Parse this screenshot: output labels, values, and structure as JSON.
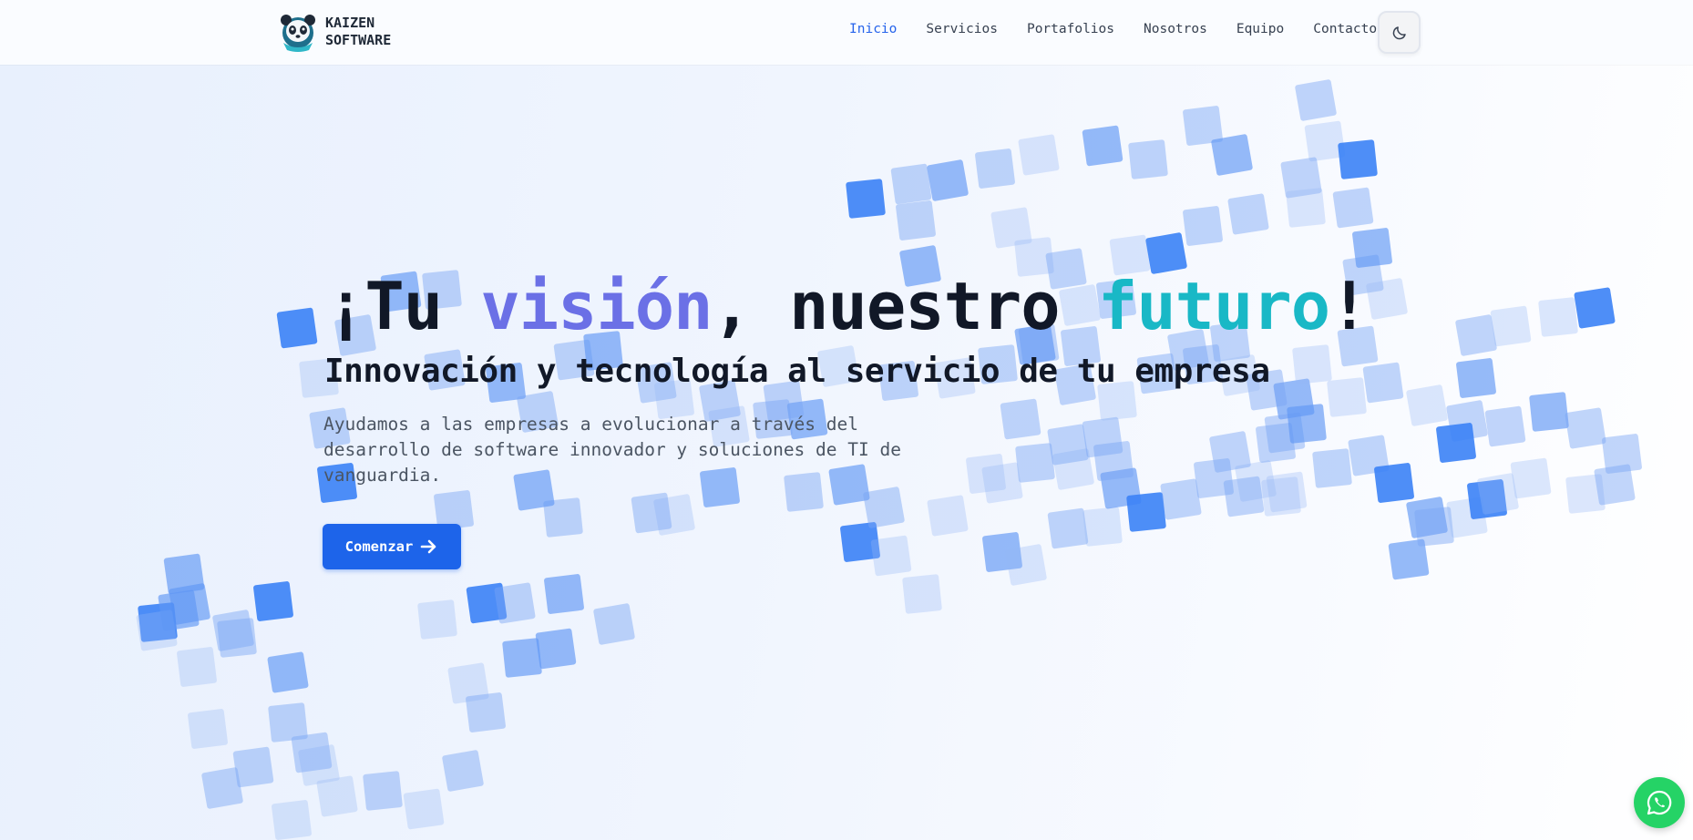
{
  "brand": {
    "name_line1": "KAIZEN",
    "name_line2": "SOFTWARE",
    "logo_icon": "panda-logo-icon"
  },
  "nav": {
    "items": [
      {
        "label": "Inicio",
        "active": true
      },
      {
        "label": "Servicios",
        "active": false
      },
      {
        "label": "Portafolios",
        "active": false
      },
      {
        "label": "Nosotros",
        "active": false
      },
      {
        "label": "Equipo",
        "active": false
      },
      {
        "label": "Contactos",
        "active": false
      }
    ],
    "theme_toggle_icon": "moon-icon"
  },
  "hero": {
    "title_part1": "¡Tu ",
    "title_highlight1": "visión",
    "title_part2": ", nuestro ",
    "title_highlight2": "futuro",
    "title_part3": "!",
    "subtitle": "Innovación y tecnología al servicio de tu empresa",
    "description": "Ayudamos a las empresas a evolucionar a través del desarrollo de software innovador y soluciones de TI de vanguardia.",
    "cta_label": "Comenzar",
    "cta_icon": "arrow-right-icon"
  },
  "floating": {
    "whatsapp_icon": "whatsapp-icon"
  },
  "colors": {
    "accent": "#1d64ea",
    "active_nav": "#2563eb",
    "highlight_purple": "#6b70e6",
    "highlight_teal": "#19b8c6",
    "whatsapp": "#25d366",
    "tile": "#3b82f6"
  }
}
